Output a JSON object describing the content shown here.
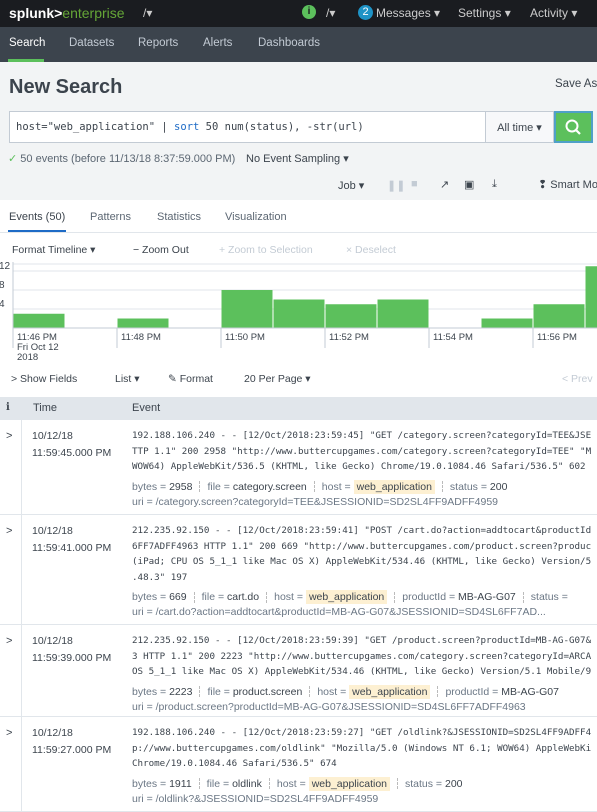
{
  "topbar": {
    "logo": "splunk>enterprise",
    "logo_left": "splunk>",
    "logo_right": "enterprise",
    "info_badge": "i",
    "messages_count": "2",
    "messages": "Messages ▾",
    "settings": "Settings ▾",
    "activity": "Activity ▾"
  },
  "nav": {
    "items": [
      "Search",
      "Datasets",
      "Reports",
      "Alerts",
      "Dashboards"
    ],
    "active": "Search"
  },
  "page": {
    "title": "New Search",
    "save_as": "Save As"
  },
  "search": {
    "query_part1": "host=\"web_application\" | ",
    "query_cmd": "sort",
    "query_part2": " 50 num(status), -str(url)",
    "time_range": "All time ▾"
  },
  "status": {
    "check": "✓",
    "summary": "50 events (before 11/13/18 8:37:59.000 PM)",
    "sampling": "No Event Sampling ▾"
  },
  "jobbar": {
    "job": "Job ▾",
    "smart_mode": "Smart Mo"
  },
  "tabs": {
    "items": [
      "Events (50)",
      "Patterns",
      "Statistics",
      "Visualization"
    ],
    "active": "Events (50)"
  },
  "timeline_toolbar": {
    "format": "Format Timeline ▾",
    "zoom_out": "− Zoom Out",
    "zoom_sel": "+ Zoom to Selection",
    "deselect": "× Deselect"
  },
  "chart_data": {
    "type": "bar",
    "y_ticks": [
      "4",
      "8",
      "12"
    ],
    "ylim": [
      0,
      13
    ],
    "x_labels": [
      "11:46 PM",
      "11:48 PM",
      "11:50 PM",
      "11:52 PM",
      "11:54 PM",
      "11:56 PM"
    ],
    "x_first_sub": [
      "Fri Oct 12",
      "2018"
    ],
    "categories": [
      "11:46 PM",
      "11:47 PM",
      "11:48 PM",
      "11:49 PM",
      "11:50 PM",
      "11:51 PM",
      "11:52 PM",
      "11:53 PM",
      "11:54 PM",
      "11:55 PM",
      "11:56 PM",
      "11:57 PM"
    ],
    "values": [
      3,
      0,
      2,
      0,
      8,
      6,
      5,
      6,
      0,
      2,
      5,
      13
    ],
    "color": "#5cc05c"
  },
  "results_toolbar": {
    "show_fields": "> Show Fields",
    "list": "List ▾",
    "format": "✎ Format",
    "per_page": "20 Per Page ▾",
    "prev": "< Prev"
  },
  "table": {
    "col_info": "i",
    "col_time": "Time",
    "col_event": "Event"
  },
  "events": [
    {
      "date": "10/12/18",
      "time": "11:59:45.000 PM",
      "lines": [
        "192.188.106.240 - - [12/Oct/2018:23:59:45] \"GET /category.screen?categoryId=TEE&JSE",
        "TTP 1.1\" 200 2958 \"http://www.buttercupgames.com/category.screen?categoryId=TEE\" \"M",
        "WOW64) AppleWebKit/536.5 (KHTML, like Gecko) Chrome/19.0.1084.46 Safari/536.5\" 602"
      ],
      "fields": [
        {
          "k": "bytes",
          "v": "2958"
        },
        {
          "k": "file",
          "v": "category.screen"
        },
        {
          "k": "host",
          "v": "web_application",
          "hl": true
        },
        {
          "k": "status",
          "v": "200"
        }
      ],
      "uri": "uri = /category.screen?categoryId=TEE&JSESSIONID=SD2SL4FF9ADFF4959"
    },
    {
      "date": "10/12/18",
      "time": "11:59:41.000 PM",
      "lines": [
        "212.235.92.150 - - [12/Oct/2018:23:59:41] \"POST /cart.do?action=addtocart&productId",
        "6FF7ADFF4963 HTTP 1.1\" 200 669 \"http://www.buttercupgames.com/product.screen?produc",
        "(iPad; CPU OS 5_1_1 like Mac OS X) AppleWebKit/534.46 (KHTML, like Gecko) Version/5",
        ".48.3\" 197"
      ],
      "fields": [
        {
          "k": "bytes",
          "v": "669"
        },
        {
          "k": "file",
          "v": "cart.do"
        },
        {
          "k": "host",
          "v": "web_application",
          "hl": true
        },
        {
          "k": "productId",
          "v": "MB-AG-G07"
        },
        {
          "k": "status",
          "v": ""
        }
      ],
      "uri": "uri = /cart.do?action=addtocart&productId=MB-AG-G07&JSESSIONID=SD4SL6FF7AD..."
    },
    {
      "date": "10/12/18",
      "time": "11:59:39.000 PM",
      "lines": [
        "212.235.92.150 - - [12/Oct/2018:23:59:39] \"GET /product.screen?productId=MB-AG-G07&",
        "3 HTTP 1.1\" 200 2223 \"http://www.buttercupgames.com/category.screen?categoryId=ARCA",
        "OS 5_1_1 like Mac OS X) AppleWebKit/534.46 (KHTML, like Gecko) Version/5.1 Mobile/9"
      ],
      "fields": [
        {
          "k": "bytes",
          "v": "2223"
        },
        {
          "k": "file",
          "v": "product.screen"
        },
        {
          "k": "host",
          "v": "web_application",
          "hl": true
        },
        {
          "k": "productId",
          "v": "MB-AG-G07"
        }
      ],
      "uri": "uri = /product.screen?productId=MB-AG-G07&JSESSIONID=SD4SL6FF7ADFF4963"
    },
    {
      "date": "10/12/18",
      "time": "11:59:27.000 PM",
      "lines": [
        "192.188.106.240 - - [12/Oct/2018:23:59:27] \"GET /oldlink?&JSESSIONID=SD2SL4FF9ADFF4",
        "p://www.buttercupgames.com/oldlink\" \"Mozilla/5.0 (Windows NT 6.1; WOW64) AppleWebKi",
        "Chrome/19.0.1084.46 Safari/536.5\" 674"
      ],
      "fields": [
        {
          "k": "bytes",
          "v": "1911"
        },
        {
          "k": "file",
          "v": "oldlink"
        },
        {
          "k": "host",
          "v": "web_application",
          "hl": true
        },
        {
          "k": "status",
          "v": "200"
        }
      ],
      "uri": "uri = /oldlink?&JSESSIONID=SD2SL4FF9ADFF4959"
    }
  ]
}
